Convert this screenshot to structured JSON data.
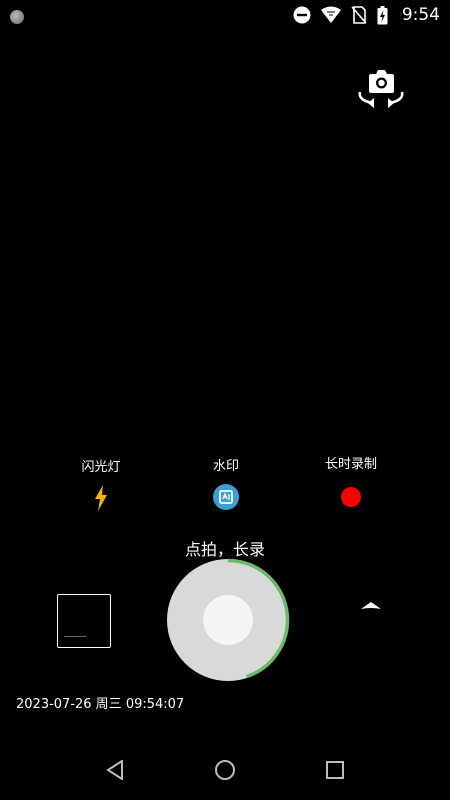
{
  "status_bar": {
    "time": "9:54",
    "icons": [
      "do-not-disturb-icon",
      "wifi-icon",
      "no-sim-icon",
      "battery-charging-icon"
    ]
  },
  "top_controls": {
    "switch_camera_icon": "switch-camera-icon"
  },
  "features": [
    {
      "label": "闪光灯",
      "icon": "flash-icon"
    },
    {
      "label": "水印",
      "icon": "watermark-icon"
    },
    {
      "label": "长时录制",
      "icon": "record-dot-icon"
    }
  ],
  "capture_hint": "点拍，长录",
  "shutter": {
    "progress": 0.45,
    "ring_color": "#6aba6a"
  },
  "timestamp": "2023-07-26 周三 09:54:07",
  "colors": {
    "flash": "#f4b400",
    "watermark": "#3a9fd6",
    "record": "#ff0000",
    "background": "#000000"
  },
  "nav_bar": {
    "buttons": [
      "back-icon",
      "home-icon",
      "recents-icon"
    ]
  }
}
